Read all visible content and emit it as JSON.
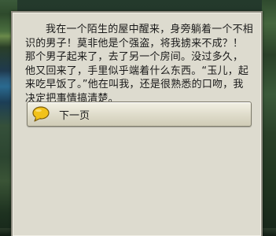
{
  "dialog": {
    "text": "我在一个陌生的屋中醒来，身旁躺着一个不相识的男子！莫非他是个强盗，将我掳来不成？！那个男子起来了，去了另一个房间。没过多久，他又回来了，手里似乎端着什么东西。“玉儿，起来吃早饭了。”他在叫我，还是很熟悉的口吻，我决定把事情搞清楚。"
  },
  "choices": [
    {
      "label": "下一页",
      "icon": "speech-bubble-icon"
    }
  ],
  "colors": {
    "panel": "#dddbcf",
    "panel_border": "#8e8c80",
    "icon_fill": "#f2c21b",
    "icon_stroke": "#7a5a08"
  }
}
